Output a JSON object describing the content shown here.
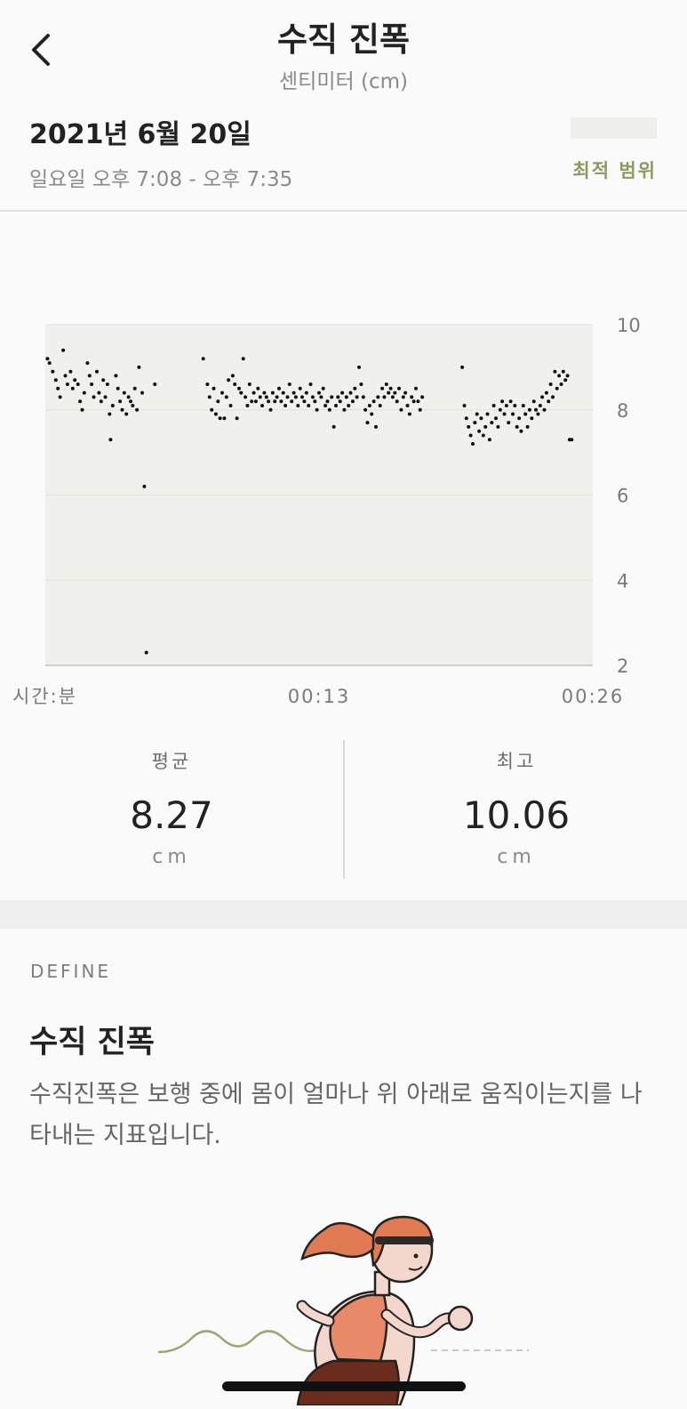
{
  "header": {
    "title": "수직 진폭",
    "subtitle": "센티미터 (cm)",
    "date": "2021년 6월 20일",
    "time_range": "일요일 오후 7:08 - 오후 7:35",
    "optimal_range_label": "최적 범위"
  },
  "chart_data": {
    "type": "scatter",
    "xlabel": "시간:분",
    "x_ticks": [
      "00:13",
      "00:26"
    ],
    "y_ticks": [
      "10",
      "8",
      "6",
      "4",
      "2"
    ],
    "ylim": [
      2,
      10
    ],
    "xlim": [
      0,
      26
    ],
    "x_unit": "minutes",
    "points": [
      [
        0.1,
        9.2
      ],
      [
        0.2,
        9.1
      ],
      [
        0.35,
        8.9
      ],
      [
        0.5,
        8.7
      ],
      [
        0.6,
        8.5
      ],
      [
        0.7,
        8.3
      ],
      [
        0.85,
        9.4
      ],
      [
        0.95,
        8.8
      ],
      [
        1.05,
        8.6
      ],
      [
        1.2,
        8.9
      ],
      [
        1.3,
        8.5
      ],
      [
        1.4,
        8.7
      ],
      [
        1.55,
        8.6
      ],
      [
        1.65,
        8.2
      ],
      [
        1.75,
        8.0
      ],
      [
        1.85,
        8.4
      ],
      [
        2.0,
        9.1
      ],
      [
        2.1,
        8.8
      ],
      [
        2.2,
        8.6
      ],
      [
        2.3,
        8.3
      ],
      [
        2.45,
        8.9
      ],
      [
        2.55,
        8.4
      ],
      [
        2.65,
        8.2
      ],
      [
        2.75,
        8.7
      ],
      [
        2.85,
        8.3
      ],
      [
        2.95,
        8.6
      ],
      [
        3.05,
        7.9
      ],
      [
        3.1,
        7.3
      ],
      [
        3.2,
        8.1
      ],
      [
        3.35,
        8.8
      ],
      [
        3.45,
        8.5
      ],
      [
        3.55,
        8.2
      ],
      [
        3.65,
        8.0
      ],
      [
        3.75,
        8.4
      ],
      [
        3.85,
        7.9
      ],
      [
        3.95,
        8.3
      ],
      [
        4.05,
        8.2
      ],
      [
        4.15,
        8.1
      ],
      [
        4.25,
        8.5
      ],
      [
        4.35,
        8.0
      ],
      [
        4.45,
        9.0
      ],
      [
        4.6,
        8.4
      ],
      [
        4.7,
        6.2
      ],
      [
        4.8,
        2.3
      ],
      [
        5.2,
        8.6
      ],
      [
        7.5,
        9.2
      ],
      [
        7.7,
        8.6
      ],
      [
        7.8,
        8.3
      ],
      [
        7.9,
        8.0
      ],
      [
        8.0,
        8.5
      ],
      [
        8.1,
        7.9
      ],
      [
        8.2,
        8.2
      ],
      [
        8.3,
        7.8
      ],
      [
        8.4,
        8.4
      ],
      [
        8.5,
        7.8
      ],
      [
        8.6,
        8.3
      ],
      [
        8.7,
        8.7
      ],
      [
        8.8,
        8.1
      ],
      [
        8.9,
        8.8
      ],
      [
        9.0,
        8.6
      ],
      [
        9.1,
        7.8
      ],
      [
        9.2,
        8.5
      ],
      [
        9.3,
        8.4
      ],
      [
        9.4,
        9.2
      ],
      [
        9.5,
        8.3
      ],
      [
        9.6,
        8.1
      ],
      [
        9.7,
        8.6
      ],
      [
        9.8,
        8.2
      ],
      [
        9.9,
        8.4
      ],
      [
        10.0,
        8.2
      ],
      [
        10.1,
        8.5
      ],
      [
        10.2,
        8.3
      ],
      [
        10.3,
        8.1
      ],
      [
        10.4,
        8.4
      ],
      [
        10.5,
        8.3
      ],
      [
        10.6,
        8.2
      ],
      [
        10.7,
        8.0
      ],
      [
        10.8,
        8.4
      ],
      [
        10.9,
        8.2
      ],
      [
        11.0,
        8.3
      ],
      [
        11.1,
        8.5
      ],
      [
        11.2,
        8.2
      ],
      [
        11.3,
        8.4
      ],
      [
        11.4,
        8.1
      ],
      [
        11.5,
        8.3
      ],
      [
        11.6,
        8.6
      ],
      [
        11.7,
        8.2
      ],
      [
        11.8,
        8.4
      ],
      [
        11.9,
        8.3
      ],
      [
        12.0,
        8.1
      ],
      [
        12.1,
        8.5
      ],
      [
        12.2,
        8.3
      ],
      [
        12.3,
        8.2
      ],
      [
        12.4,
        8.4
      ],
      [
        12.5,
        8.1
      ],
      [
        12.6,
        8.6
      ],
      [
        12.7,
        8.3
      ],
      [
        12.8,
        8.2
      ],
      [
        12.9,
        8.0
      ],
      [
        13.0,
        8.4
      ],
      [
        13.1,
        8.3
      ],
      [
        13.2,
        8.5
      ],
      [
        13.3,
        8.1
      ],
      [
        13.4,
        8.2
      ],
      [
        13.5,
        8.0
      ],
      [
        13.6,
        8.3
      ],
      [
        13.7,
        7.6
      ],
      [
        13.8,
        8.1
      ],
      [
        13.9,
        8.3
      ],
      [
        14.0,
        8.2
      ],
      [
        14.1,
        8.4
      ],
      [
        14.2,
        8.0
      ],
      [
        14.3,
        8.3
      ],
      [
        14.4,
        8.1
      ],
      [
        14.5,
        8.4
      ],
      [
        14.6,
        8.2
      ],
      [
        14.7,
        8.5
      ],
      [
        14.8,
        8.3
      ],
      [
        14.9,
        9.0
      ],
      [
        15.0,
        8.6
      ],
      [
        15.1,
        8.3
      ],
      [
        15.2,
        8.0
      ],
      [
        15.3,
        7.7
      ],
      [
        15.4,
        8.1
      ],
      [
        15.5,
        7.9
      ],
      [
        15.6,
        8.2
      ],
      [
        15.7,
        7.6
      ],
      [
        15.8,
        8.3
      ],
      [
        15.9,
        8.1
      ],
      [
        16.0,
        8.5
      ],
      [
        16.1,
        8.3
      ],
      [
        16.2,
        8.6
      ],
      [
        16.3,
        8.4
      ],
      [
        16.4,
        8.5
      ],
      [
        16.5,
        8.3
      ],
      [
        16.6,
        8.4
      ],
      [
        16.7,
        8.2
      ],
      [
        16.8,
        8.5
      ],
      [
        16.9,
        8.0
      ],
      [
        17.0,
        8.3
      ],
      [
        17.1,
        8.4
      ],
      [
        17.2,
        8.1
      ],
      [
        17.3,
        7.9
      ],
      [
        17.4,
        8.3
      ],
      [
        17.5,
        8.2
      ],
      [
        17.6,
        8.5
      ],
      [
        17.7,
        8.2
      ],
      [
        17.8,
        8.0
      ],
      [
        17.9,
        8.3
      ],
      [
        19.8,
        9.0
      ],
      [
        19.9,
        8.1
      ],
      [
        20.0,
        7.8
      ],
      [
        20.1,
        7.6
      ],
      [
        20.2,
        7.4
      ],
      [
        20.3,
        7.2
      ],
      [
        20.4,
        7.7
      ],
      [
        20.5,
        7.9
      ],
      [
        20.6,
        7.5
      ],
      [
        20.7,
        7.8
      ],
      [
        20.8,
        7.4
      ],
      [
        20.9,
        7.6
      ],
      [
        21.0,
        7.9
      ],
      [
        21.1,
        7.3
      ],
      [
        21.2,
        7.7
      ],
      [
        21.3,
        8.1
      ],
      [
        21.4,
        7.8
      ],
      [
        21.5,
        7.6
      ],
      [
        21.6,
        8.0
      ],
      [
        21.7,
        8.2
      ],
      [
        21.8,
        7.9
      ],
      [
        21.9,
        8.1
      ],
      [
        22.0,
        7.7
      ],
      [
        22.1,
        8.2
      ],
      [
        22.2,
        7.9
      ],
      [
        22.3,
        8.1
      ],
      [
        22.4,
        7.6
      ],
      [
        22.5,
        7.8
      ],
      [
        22.6,
        7.5
      ],
      [
        22.7,
        8.1
      ],
      [
        22.8,
        7.9
      ],
      [
        22.9,
        7.6
      ],
      [
        23.0,
        8.0
      ],
      [
        23.1,
        7.8
      ],
      [
        23.2,
        8.2
      ],
      [
        23.3,
        8.0
      ],
      [
        23.4,
        7.9
      ],
      [
        23.5,
        8.1
      ],
      [
        23.6,
        8.3
      ],
      [
        23.7,
        8.0
      ],
      [
        23.8,
        8.4
      ],
      [
        23.9,
        8.2
      ],
      [
        24.0,
        8.6
      ],
      [
        24.1,
        8.3
      ],
      [
        24.2,
        8.9
      ],
      [
        24.3,
        8.5
      ],
      [
        24.4,
        8.8
      ],
      [
        24.5,
        8.6
      ],
      [
        24.6,
        8.9
      ],
      [
        24.7,
        8.7
      ],
      [
        24.8,
        8.8
      ],
      [
        24.9,
        7.3
      ],
      [
        25.0,
        7.3
      ]
    ]
  },
  "stats": {
    "average": {
      "label": "평균",
      "value": "8.27",
      "unit": "cm"
    },
    "max": {
      "label": "최고",
      "value": "10.06",
      "unit": "cm"
    }
  },
  "define": {
    "tag": "DEFINE",
    "title": "수직 진폭",
    "body": "수직진폭은 보행 중에 몸이 얼마나 위 아래로 움직이는지를 나타내는 지표입니다."
  },
  "colors": {
    "accent": "#8a9b5f",
    "chart_band": "#f0f0ec",
    "point": "#111111"
  }
}
